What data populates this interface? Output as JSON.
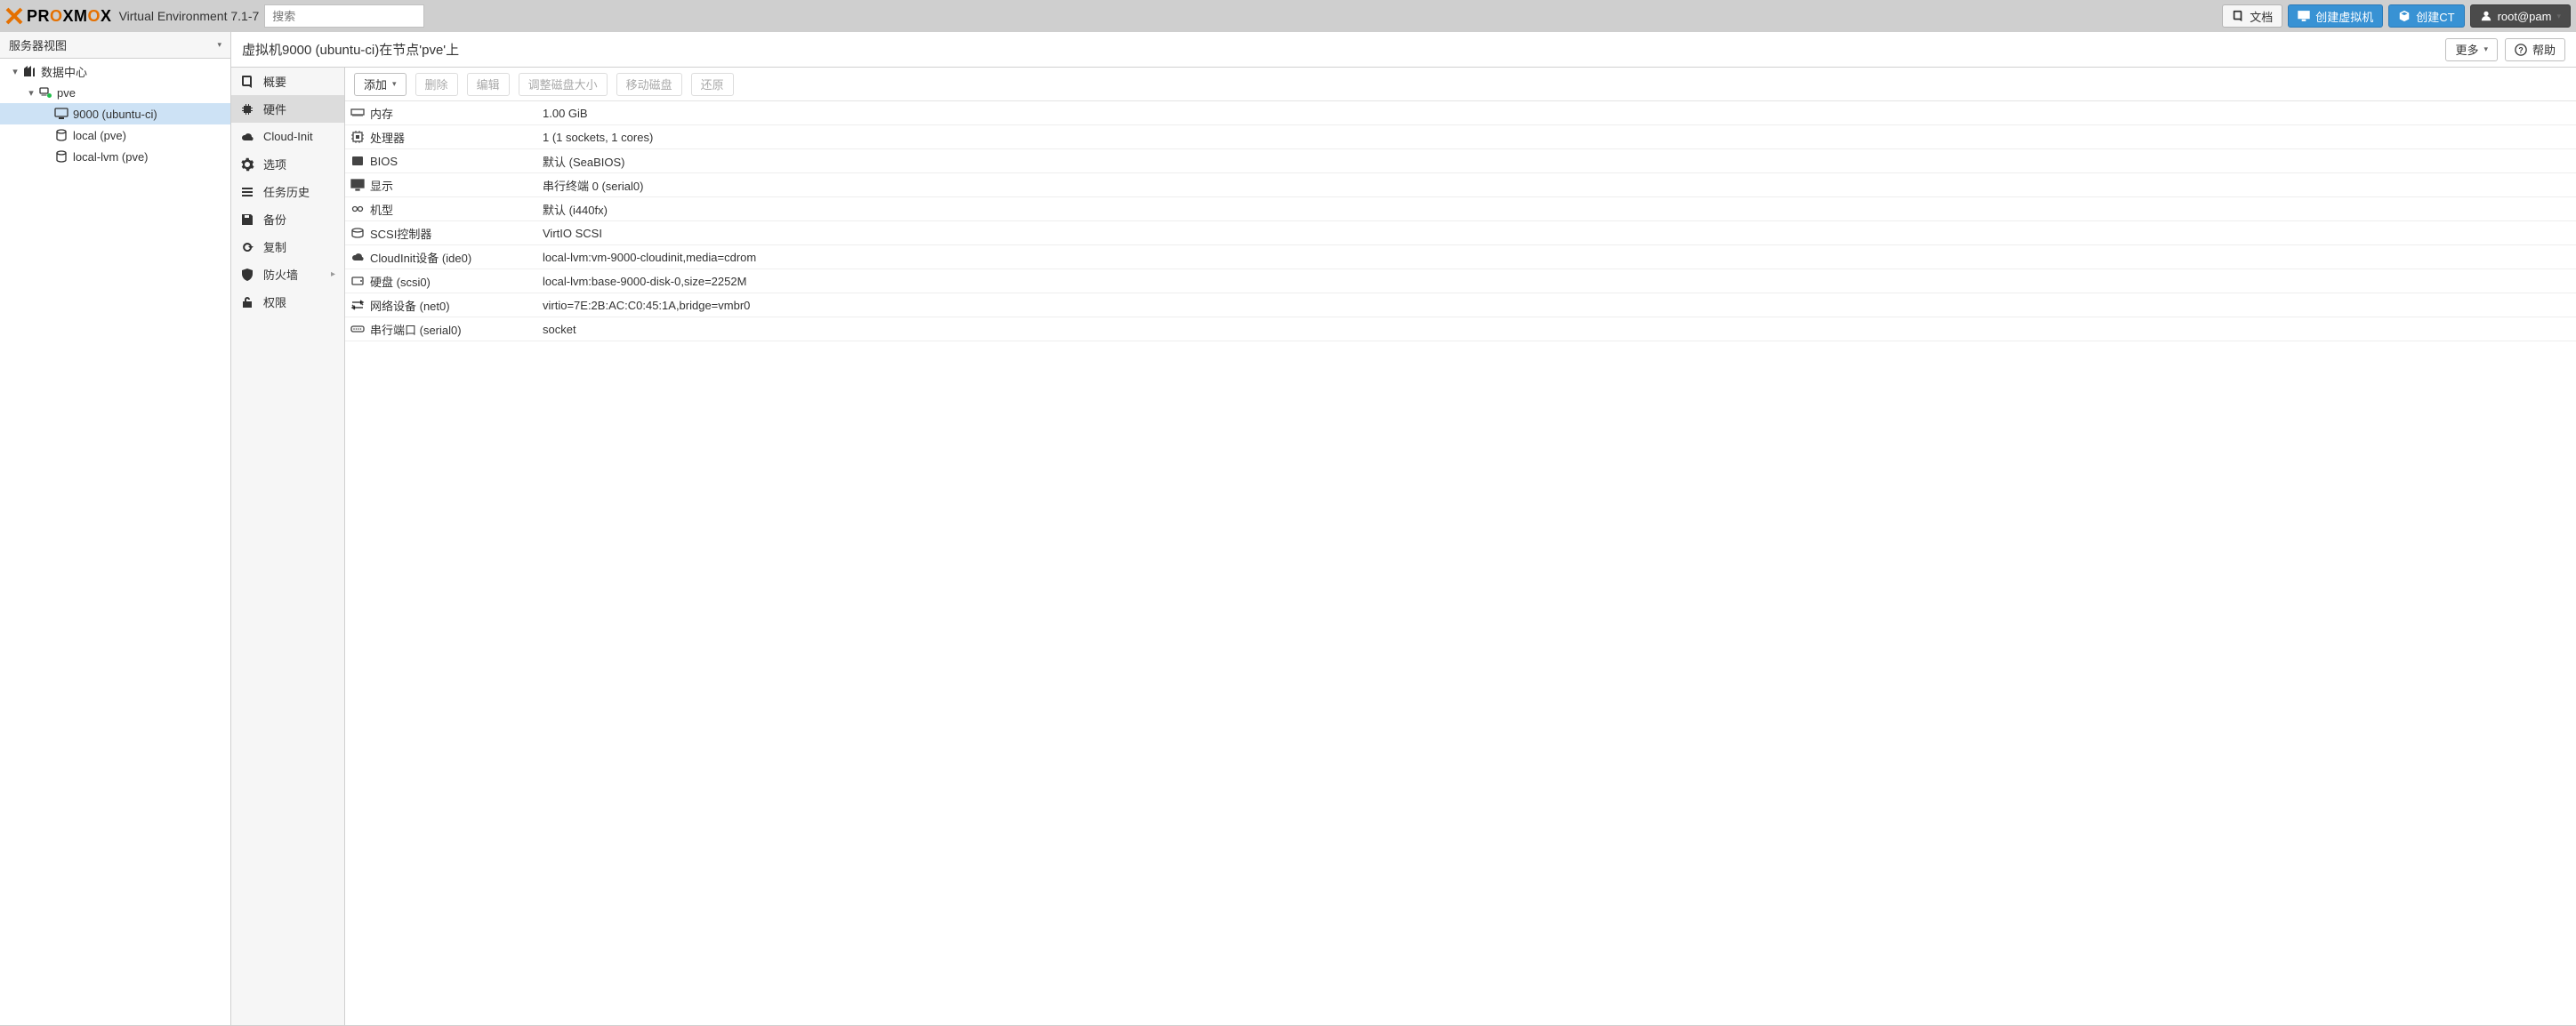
{
  "header": {
    "product": "PROXMOX",
    "version_label": "Virtual Environment 7.1-7",
    "search_placeholder": "搜索",
    "docs": "文档",
    "create_vm": "创建虚拟机",
    "create_ct": "创建CT",
    "user": "root@pam"
  },
  "tree": {
    "view_label": "服务器视图",
    "nodes": [
      {
        "id": "datacenter",
        "label": "数据中心",
        "depth": 0,
        "icon": "server",
        "expanded": true
      },
      {
        "id": "pve",
        "label": "pve",
        "depth": 1,
        "icon": "node-green",
        "expanded": true
      },
      {
        "id": "vm9000",
        "label": "9000 (ubuntu-ci)",
        "depth": 2,
        "icon": "vm",
        "selected": true
      },
      {
        "id": "local",
        "label": "local (pve)",
        "depth": 2,
        "icon": "storage"
      },
      {
        "id": "locallvm",
        "label": "local-lvm (pve)",
        "depth": 2,
        "icon": "storage"
      }
    ]
  },
  "content": {
    "title": "虚拟机9000 (ubuntu-ci)在节点'pve'上",
    "more": "更多",
    "help": "帮助"
  },
  "menu": {
    "items": [
      {
        "id": "summary",
        "label": "概要",
        "icon": "book"
      },
      {
        "id": "hardware",
        "label": "硬件",
        "icon": "chip",
        "selected": true
      },
      {
        "id": "cloudinit",
        "label": "Cloud-Init",
        "icon": "cloud"
      },
      {
        "id": "options",
        "label": "选项",
        "icon": "gear"
      },
      {
        "id": "taskhist",
        "label": "任务历史",
        "icon": "list"
      },
      {
        "id": "backup",
        "label": "备份",
        "icon": "save"
      },
      {
        "id": "replication",
        "label": "复制",
        "icon": "refresh"
      },
      {
        "id": "firewall",
        "label": "防火墙",
        "icon": "shield",
        "has_sub": true
      },
      {
        "id": "perm",
        "label": "权限",
        "icon": "unlock"
      }
    ]
  },
  "hw_toolbar": {
    "add": "添加",
    "remove": "删除",
    "edit": "编辑",
    "resize": "调整磁盘大小",
    "move": "移动磁盘",
    "restore": "还原"
  },
  "hardware": [
    {
      "icon": "memory",
      "key": "内存",
      "value": "1.00 GiB"
    },
    {
      "icon": "cpu",
      "key": "处理器",
      "value": "1 (1 sockets, 1 cores)"
    },
    {
      "icon": "bios",
      "key": "BIOS",
      "value": "默认 (SeaBIOS)"
    },
    {
      "icon": "display",
      "key": "显示",
      "value": "串行终端 0 (serial0)"
    },
    {
      "icon": "machine",
      "key": "机型",
      "value": "默认 (i440fx)"
    },
    {
      "icon": "scsi",
      "key": "SCSI控制器",
      "value": "VirtIO SCSI"
    },
    {
      "icon": "cloud",
      "key": "CloudInit设备 (ide0)",
      "value": "local-lvm:vm-9000-cloudinit,media=cdrom"
    },
    {
      "icon": "disk",
      "key": "硬盘 (scsi0)",
      "value": "local-lvm:base-9000-disk-0,size=2252M"
    },
    {
      "icon": "net",
      "key": "网络设备 (net0)",
      "value": "virtio=7E:2B:AC:C0:45:1A,bridge=vmbr0"
    },
    {
      "icon": "serial",
      "key": "串行端口 (serial0)",
      "value": "socket"
    }
  ]
}
